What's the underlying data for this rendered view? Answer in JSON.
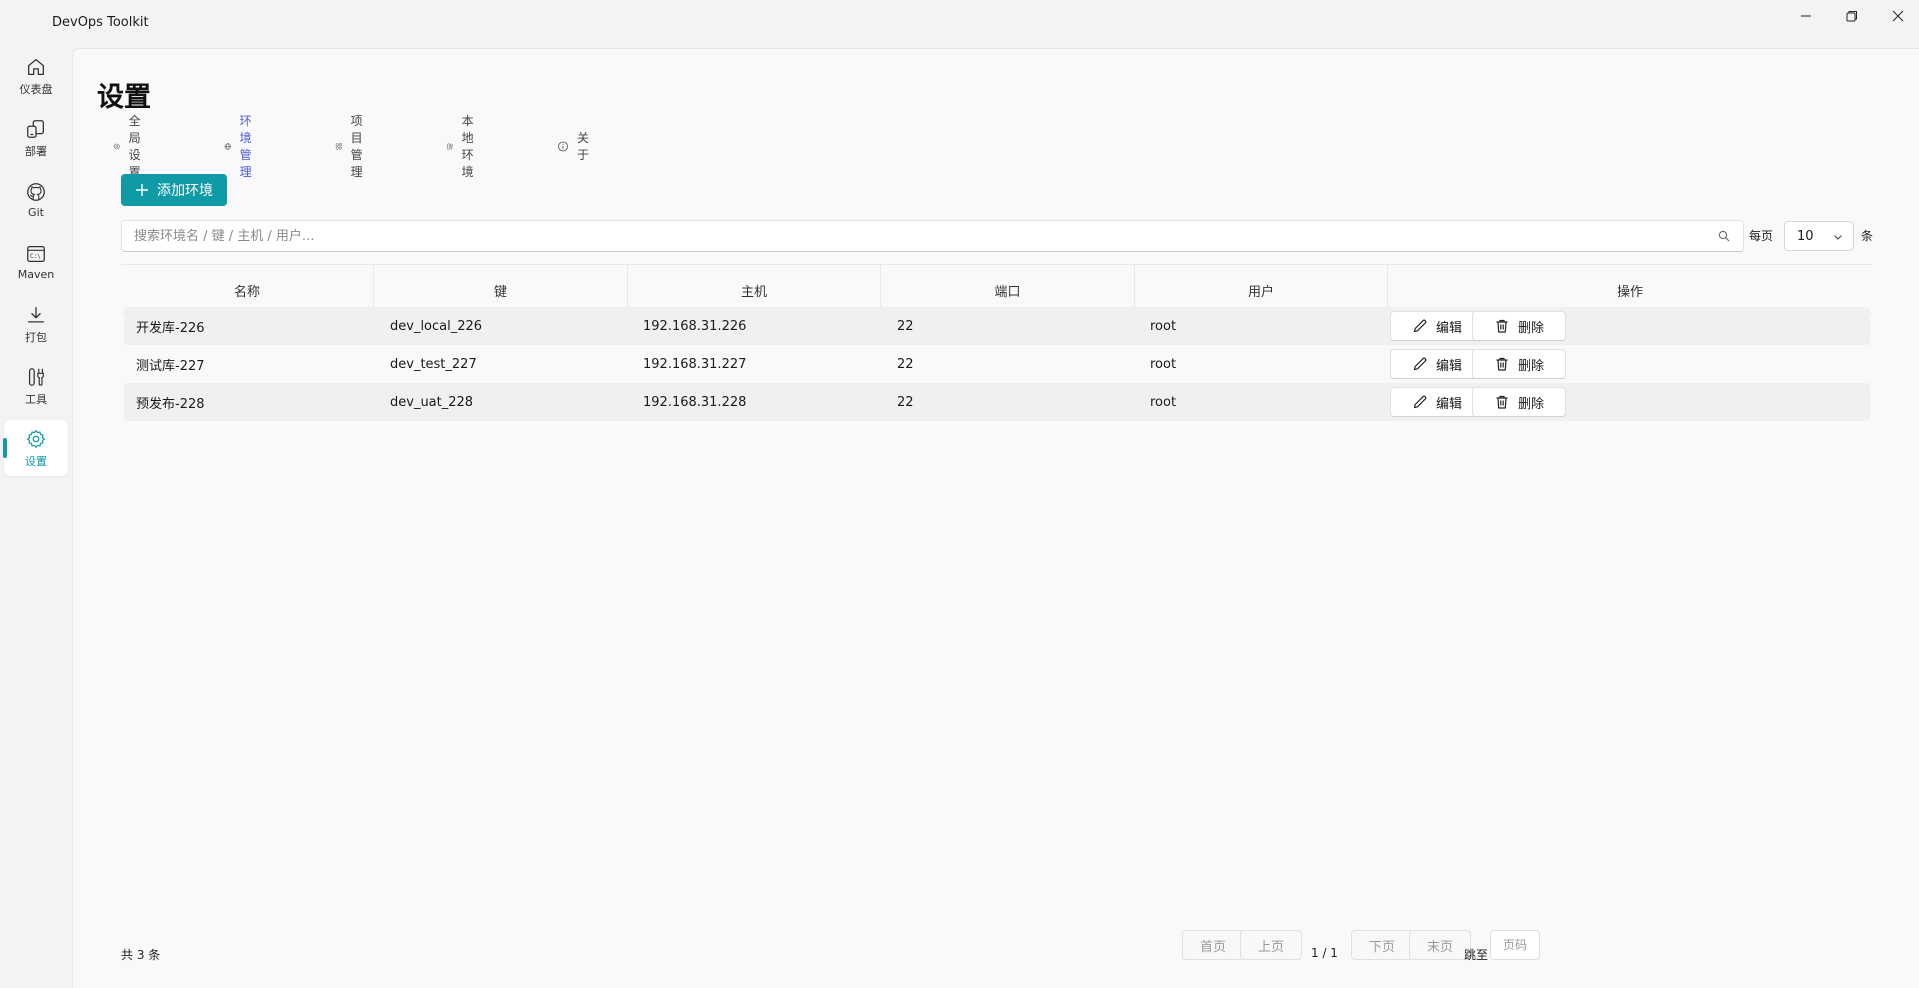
{
  "app": {
    "title": "DevOps Toolkit"
  },
  "nav": {
    "items": [
      {
        "label": "仪表盘",
        "icon": "home-icon"
      },
      {
        "label": "部署",
        "icon": "deploy-icon"
      },
      {
        "label": "Git",
        "icon": "github-icon"
      },
      {
        "label": "Maven",
        "icon": "terminal-icon"
      },
      {
        "label": "打包",
        "icon": "download-icon"
      },
      {
        "label": "工具",
        "icon": "tools-icon"
      },
      {
        "label": "设置",
        "icon": "gear-icon",
        "active": true
      }
    ]
  },
  "page": {
    "title": "设置"
  },
  "tabs": [
    {
      "label": "全局设置",
      "icon": "gear-icon"
    },
    {
      "label": "环境管理",
      "icon": "globe-icon",
      "active": true
    },
    {
      "label": "项目管理",
      "icon": "apps-icon"
    },
    {
      "label": "本地环境",
      "icon": "tools-icon"
    },
    {
      "label": "关于",
      "icon": "info-icon"
    }
  ],
  "toolbar": {
    "add_label": "添加环境",
    "search_placeholder": "搜索环境名 / 键 / 主机 / 用户...",
    "per_page_label": "每页",
    "per_page_value": "10",
    "per_page_unit": "条"
  },
  "table": {
    "columns": [
      "名称",
      "键",
      "主机",
      "端口",
      "用户",
      "操作"
    ],
    "rows": [
      {
        "name": "开发库-226",
        "key": "dev_local_226",
        "host": "192.168.31.226",
        "port": "22",
        "user": "root"
      },
      {
        "name": "测试库-227",
        "key": "dev_test_227",
        "host": "192.168.31.227",
        "port": "22",
        "user": "root"
      },
      {
        "name": "预发布-228",
        "key": "dev_uat_228",
        "host": "192.168.31.228",
        "port": "22",
        "user": "root"
      }
    ],
    "edit_label": "编辑",
    "delete_label": "删除"
  },
  "pagination": {
    "total": "共 3 条",
    "first": "首页",
    "prev": "上页",
    "info": "1 / 1",
    "next": "下页",
    "last": "末页",
    "jump_label": "跳至",
    "jump_placeholder": "页码"
  },
  "colors": {
    "accent": "#0f9aa6",
    "tab_active": "#4f5bd5"
  }
}
